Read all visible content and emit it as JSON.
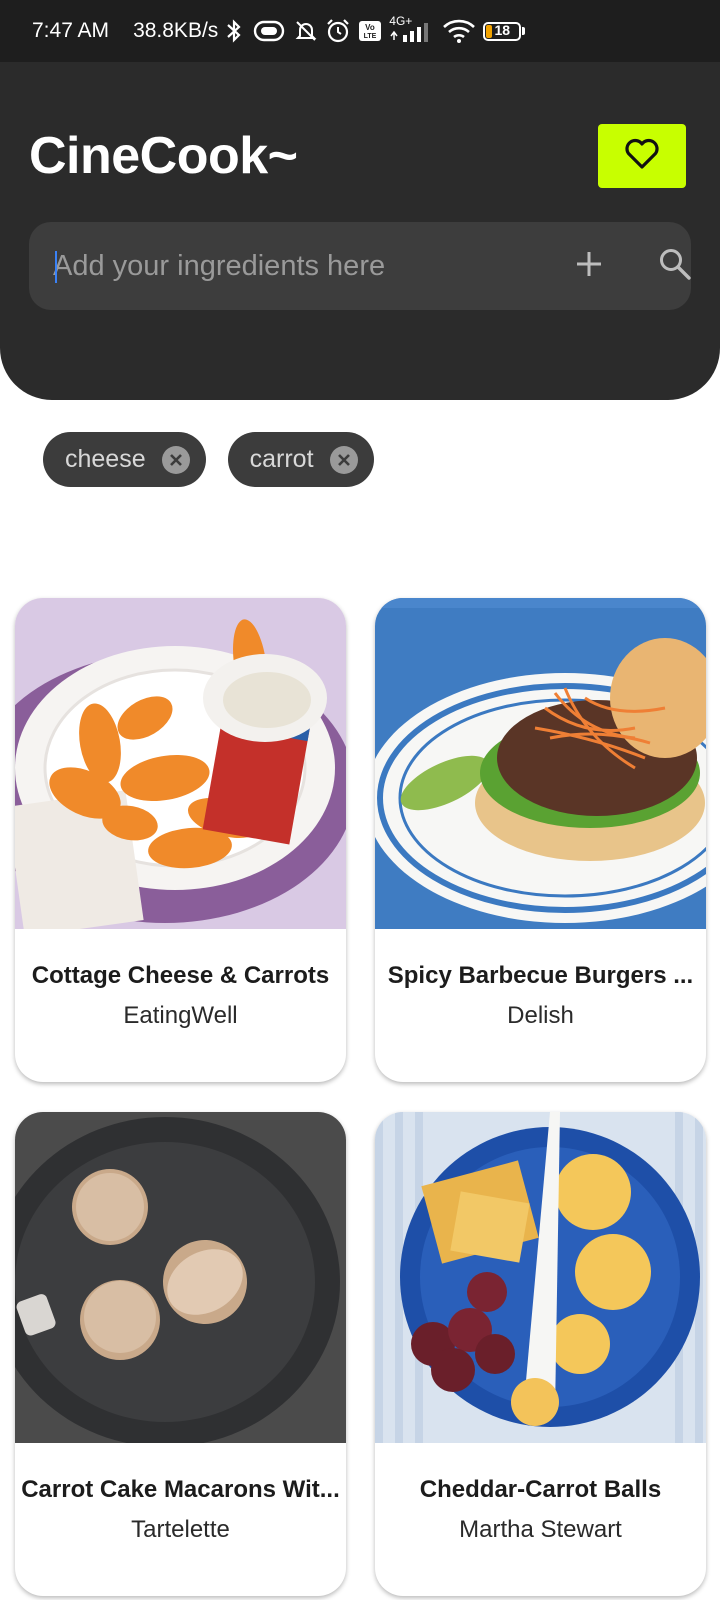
{
  "status_bar": {
    "time": "7:47 AM",
    "speed": "38.8KB/s",
    "network": "4G+",
    "battery": "18",
    "icons": [
      "bluetooth-icon",
      "vibrate-icon",
      "mute-icon",
      "alarm-icon",
      "volte-icon",
      "signal-icon",
      "wifi-icon",
      "battery-icon"
    ]
  },
  "header": {
    "title": "CineCook~",
    "favorites_icon": "heart-icon",
    "accent_color": "#c8ff00"
  },
  "search": {
    "placeholder": "Add your ingredients here",
    "value": "",
    "add_icon": "plus-icon",
    "search_icon": "search-icon"
  },
  "ingredients": [
    {
      "label": "cheese",
      "remove_icon": "close-icon"
    },
    {
      "label": "carrot",
      "remove_icon": "close-icon"
    }
  ],
  "recipes": [
    {
      "title": "Cottage Cheese & Carrots",
      "source": "EatingWell"
    },
    {
      "title": "Spicy Barbecue Burgers ...",
      "source": "Delish"
    },
    {
      "title": "Carrot Cake Macarons Wit...",
      "source": "Tartelette"
    },
    {
      "title": "Cheddar-Carrot Balls",
      "source": "Martha Stewart"
    }
  ]
}
